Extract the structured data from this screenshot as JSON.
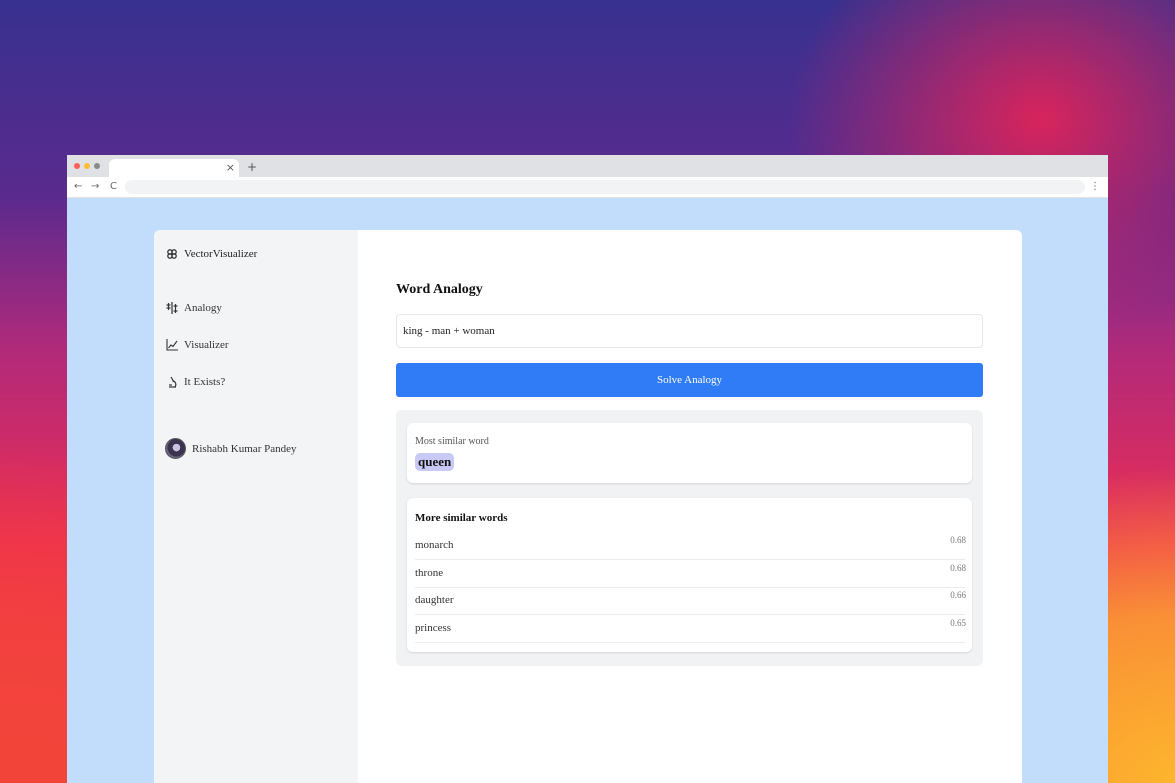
{
  "browser": {
    "tab_close": "×",
    "new_tab": "+",
    "back": "←",
    "forward": "→",
    "reload": "C",
    "menu": "⋮",
    "dot_colors": [
      "#ff5f57",
      "#febc2e",
      "#8a8a8a"
    ]
  },
  "sidebar": {
    "brand": "VectorVisualizer",
    "items": [
      {
        "label": "Analogy",
        "icon": "analogy-icon"
      },
      {
        "label": "Visualizer",
        "icon": "chart-icon"
      },
      {
        "label": "It Exists?",
        "icon": "microscope-icon"
      }
    ],
    "user": "Rishabh Kumar Pandey"
  },
  "main": {
    "title": "Word Analogy",
    "input_value": "king - man + woman",
    "solve_button": "Solve Analogy",
    "most_similar_label": "Most similar word",
    "most_similar_word": "queen",
    "more_similar_title": "More similar words",
    "similar_words": [
      {
        "word": "monarch",
        "score": "0.68"
      },
      {
        "word": "throne",
        "score": "0.68"
      },
      {
        "word": "daughter",
        "score": "0.66"
      },
      {
        "word": "princess",
        "score": "0.65"
      }
    ]
  },
  "colors": {
    "accent": "#2f7cf6",
    "highlight": "#c8c9f4",
    "page_bg": "#c2dcfb"
  }
}
